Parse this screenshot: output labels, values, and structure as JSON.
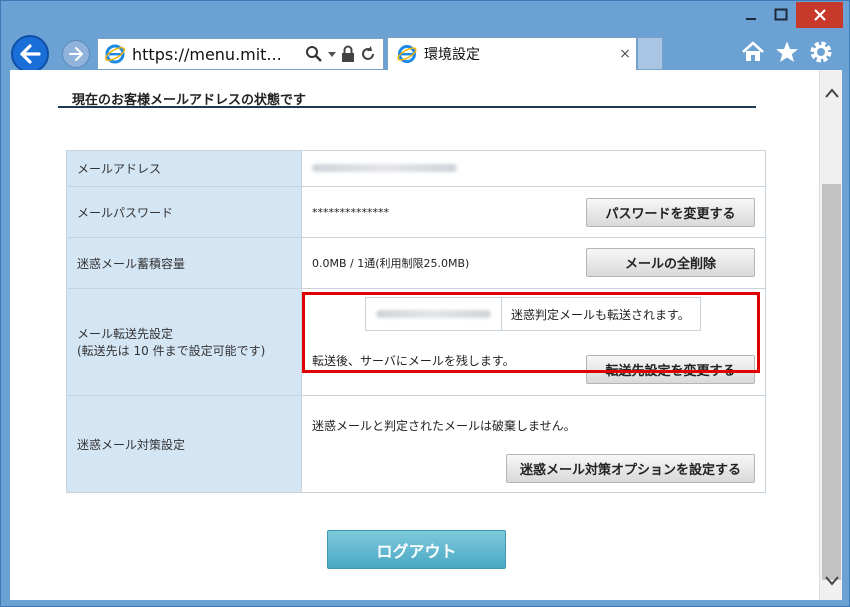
{
  "browser": {
    "url": "https://menu.mit...",
    "tab_title": "環境設定",
    "tab_close": "×",
    "window_buttons": {
      "minimize": "—",
      "maximize": "☐",
      "close": "✕"
    }
  },
  "page": {
    "section_title": "現在のお客様メールアドレスの状態です",
    "rows": {
      "email": {
        "label": "メールアドレス"
      },
      "password": {
        "label": "メールパスワード",
        "value": "**************",
        "button": "パスワードを変更する"
      },
      "storage": {
        "label": "迷惑メール蓄積容量",
        "value": "0.0MB / 1通(利用制限25.0MB)",
        "button": "メールの全削除"
      },
      "forward": {
        "label_line1": "メール転送先設定",
        "label_line2": "(転送先は 10 件まで設定可能です)",
        "note": "迷惑判定メールも転送されます。",
        "keep_text": "転送後、サーバにメールを残します。",
        "button": "転送先設定を変更する"
      },
      "spam": {
        "label": "迷惑メール対策設定",
        "value": "迷惑メールと判定されたメールは破棄しません。",
        "button": "迷惑メール対策オプションを設定する"
      }
    },
    "logout": "ログアウト"
  },
  "colors": {
    "label_bg": "#d4e5f4",
    "highlight": "#e00000",
    "logout_bg": "#4aa9c4",
    "frame": "#6ca1d3"
  }
}
